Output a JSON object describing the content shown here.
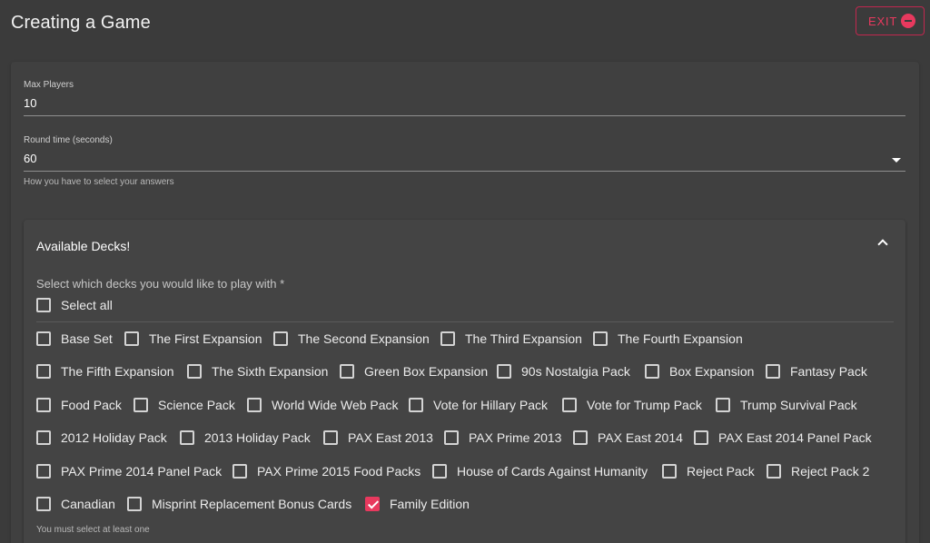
{
  "header": {
    "title": "Creating a Game",
    "exit_label": "EXIT"
  },
  "form": {
    "max_players": {
      "label": "Max Players",
      "value": "10"
    },
    "round_time": {
      "label": "Round time (seconds)",
      "value": "60",
      "helper": "How you have to select your answers"
    }
  },
  "decks_panel": {
    "title": "Available Decks!",
    "prompt": "Select which decks you would like to play with *",
    "select_all_label": "Select all",
    "error_text": "You must select at least one",
    "decks": [
      {
        "label": "Base Set",
        "checked": false
      },
      {
        "label": "The First Expansion",
        "checked": false
      },
      {
        "label": "The Second Expansion",
        "checked": false
      },
      {
        "label": "The Third Expansion",
        "checked": false
      },
      {
        "label": "The Fourth Expansion",
        "checked": false
      },
      {
        "label": "The Fifth Expansion",
        "checked": false
      },
      {
        "label": "The Sixth Expansion",
        "checked": false
      },
      {
        "label": "Green Box Expansion",
        "checked": false
      },
      {
        "label": "90s Nostalgia Pack",
        "checked": false
      },
      {
        "label": "Box Expansion",
        "checked": false
      },
      {
        "label": "Fantasy Pack",
        "checked": false
      },
      {
        "label": "Food Pack",
        "checked": false
      },
      {
        "label": "Science Pack",
        "checked": false
      },
      {
        "label": "World Wide Web Pack",
        "checked": false
      },
      {
        "label": "Vote for Hillary Pack",
        "checked": false
      },
      {
        "label": "Vote for Trump Pack",
        "checked": false
      },
      {
        "label": "Trump Survival Pack",
        "checked": false
      },
      {
        "label": "2012 Holiday Pack",
        "checked": false
      },
      {
        "label": "2013 Holiday Pack",
        "checked": false
      },
      {
        "label": "PAX East 2013",
        "checked": false
      },
      {
        "label": "PAX Prime 2013",
        "checked": false
      },
      {
        "label": "PAX East 2014",
        "checked": false
      },
      {
        "label": "PAX East 2014 Panel Pack",
        "checked": false
      },
      {
        "label": "PAX Prime 2014 Panel Pack",
        "checked": false
      },
      {
        "label": "PAX Prime 2015 Food Packs",
        "checked": false
      },
      {
        "label": "House of Cards Against Humanity",
        "checked": false
      },
      {
        "label": "Reject Pack",
        "checked": false
      },
      {
        "label": "Reject Pack 2",
        "checked": false
      },
      {
        "label": "Canadian",
        "checked": false
      },
      {
        "label": "Misprint Replacement Bonus Cards",
        "checked": false
      },
      {
        "label": "Family Edition",
        "checked": true
      }
    ]
  },
  "colors": {
    "accent": "#e8395e",
    "background": "#3b3b3b",
    "card": "#404040"
  }
}
